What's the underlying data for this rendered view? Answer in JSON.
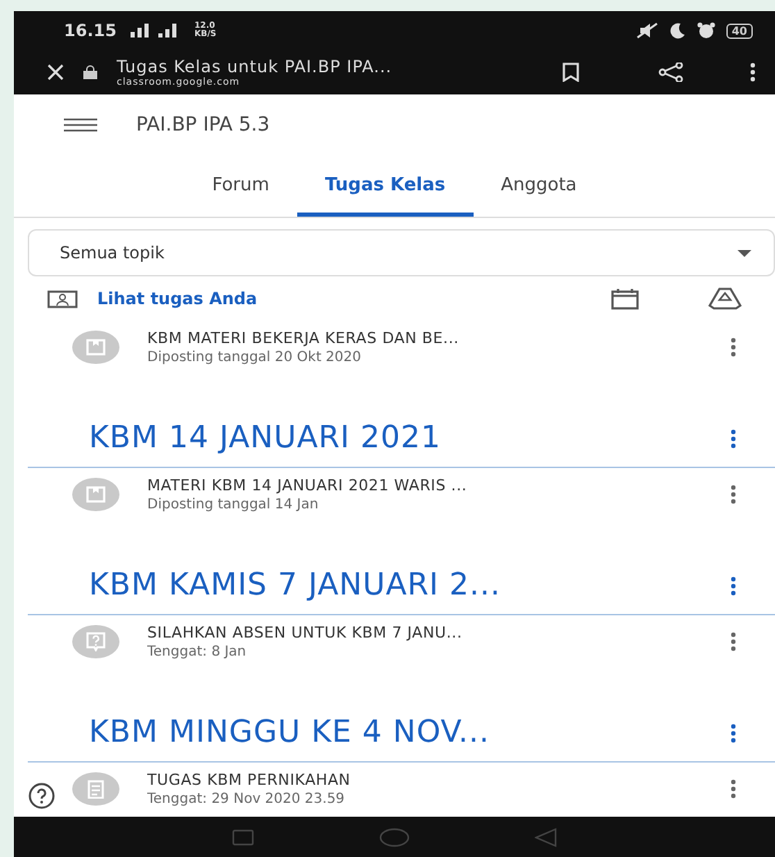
{
  "status_bar": {
    "time": "16.15",
    "speed": "12.0 KB/S",
    "battery": "40"
  },
  "browser": {
    "title": "Tugas Kelas untuk PAI.BP IPA...",
    "url": "classroom.google.com"
  },
  "app_bar": {
    "title": "PAI.BP IPA 5.3"
  },
  "tabs": [
    {
      "label": "Forum",
      "selected": false
    },
    {
      "label": "Tugas Kelas",
      "selected": true
    },
    {
      "label": "Anggota",
      "selected": false
    }
  ],
  "topic_filter": {
    "value": "Semua topik"
  },
  "view_work_link": "Lihat tugas Anda",
  "sections": [
    {
      "items": [
        {
          "kind": "material",
          "title": "KBM MATERI BEKERJA KERAS DAN BE...",
          "meta": "Diposting tanggal 20 Okt 2020"
        }
      ]
    },
    {
      "topic": "KBM 14 JANUARI 2021",
      "items": [
        {
          "kind": "material",
          "title": "MATERI KBM 14 JANUARI 2021 WARIS ...",
          "meta": "Diposting tanggal 14 Jan"
        }
      ]
    },
    {
      "topic": "KBM KAMIS 7 JANUARI 2...",
      "items": [
        {
          "kind": "question",
          "title": "SILAHKAN ABSEN UNTUK KBM 7 JANU...",
          "meta": "Tenggat: 8 Jan"
        }
      ]
    },
    {
      "topic": "KBM MINGGU KE 4 NOV...",
      "items": [
        {
          "kind": "assignment",
          "title": "TUGAS KBM PERNIKAHAN",
          "meta": "Tenggat: 29 Nov 2020 23.59"
        }
      ]
    }
  ]
}
